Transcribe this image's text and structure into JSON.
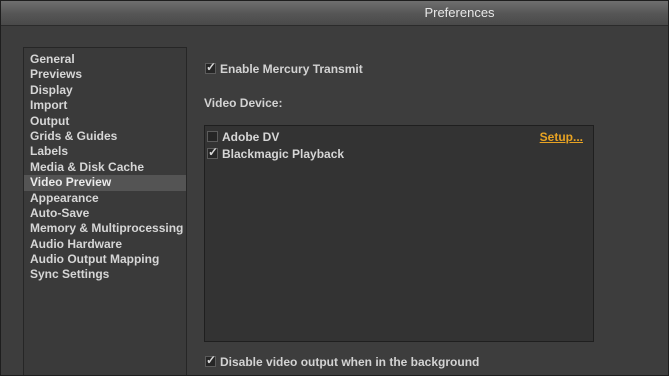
{
  "window": {
    "title": "Preferences"
  },
  "sidebar": {
    "items": [
      {
        "label": "General"
      },
      {
        "label": "Previews"
      },
      {
        "label": "Display"
      },
      {
        "label": "Import"
      },
      {
        "label": "Output"
      },
      {
        "label": "Grids & Guides"
      },
      {
        "label": "Labels"
      },
      {
        "label": "Media & Disk Cache"
      },
      {
        "label": "Video Preview",
        "selected": true
      },
      {
        "label": "Appearance"
      },
      {
        "label": "Auto-Save"
      },
      {
        "label": "Memory & Multiprocessing"
      },
      {
        "label": "Audio Hardware"
      },
      {
        "label": "Audio Output Mapping"
      },
      {
        "label": "Sync Settings"
      }
    ]
  },
  "main": {
    "enable_mercury": {
      "label": "Enable Mercury Transmit",
      "checked": true
    },
    "video_device_heading": "Video Device:",
    "devices": [
      {
        "label": "Adobe DV",
        "checked": false,
        "setup_label": "Setup..."
      },
      {
        "label": "Blackmagic Playback",
        "checked": true
      }
    ],
    "disable_background": {
      "label": "Disable video output when in the background",
      "checked": true
    }
  },
  "colors": {
    "accent_link": "#e8a323",
    "selected_row": "#545454"
  },
  "check_glyph": "✓"
}
